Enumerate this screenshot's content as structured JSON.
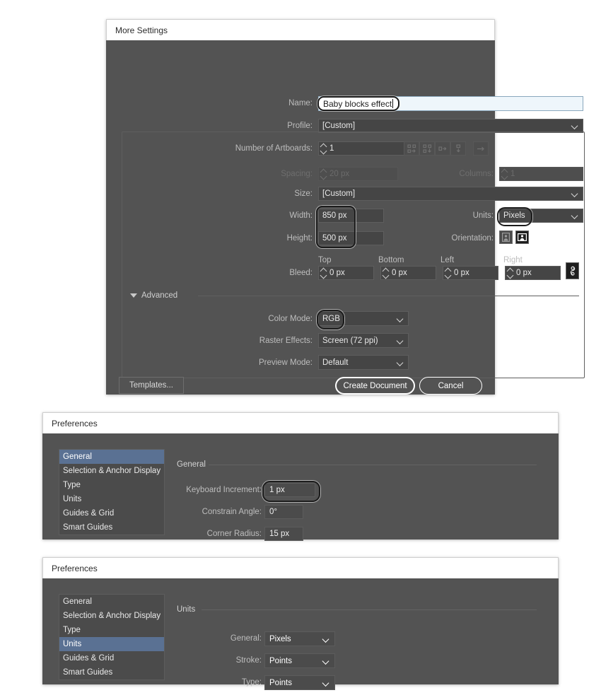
{
  "new_document": {
    "title": "More Settings",
    "name": {
      "label": "Name:",
      "value": "Baby blocks effect"
    },
    "profile": {
      "label": "Profile:",
      "value": "[Custom]"
    },
    "artboards": {
      "label": "Number of Artboards:",
      "value": "1"
    },
    "arrange_icons": [
      "grid-by-row-icon",
      "grid-by-column-icon",
      "arrange-left-to-right-icon",
      "arrange-top-to-bottom-icon",
      "change-order-icon"
    ],
    "spacing": {
      "label": "Spacing:",
      "value": "20 px",
      "disabled": true
    },
    "columns": {
      "label": "Columns:",
      "value": "1",
      "disabled": true
    },
    "size": {
      "label": "Size:",
      "value": "[Custom]"
    },
    "width": {
      "label": "Width:",
      "value": "850 px"
    },
    "height": {
      "label": "Height:",
      "value": "500 px"
    },
    "units": {
      "label": "Units:",
      "value": "Pixels"
    },
    "orientation": {
      "label": "Orientation:",
      "portrait_selected": false,
      "landscape_selected": true
    },
    "bleed": {
      "label": "Bleed:",
      "headers": [
        "Top",
        "Bottom",
        "Left",
        "Right"
      ],
      "values": [
        "0 px",
        "0 px",
        "0 px",
        "0 px"
      ],
      "link_icon": "link-chain-icon"
    },
    "advanced": {
      "label": "Advanced",
      "color_mode": {
        "label": "Color Mode:",
        "value": "RGB"
      },
      "raster_effects": {
        "label": "Raster Effects:",
        "value": "Screen (72 ppi)"
      },
      "preview_mode": {
        "label": "Preview Mode:",
        "value": "Default"
      }
    },
    "buttons": {
      "templates": "Templates...",
      "create": "Create Document",
      "cancel": "Cancel"
    }
  },
  "preferences_general": {
    "title": "Preferences",
    "sidebar": [
      {
        "label": "General",
        "selected": true
      },
      {
        "label": "Selection & Anchor Display",
        "selected": false
      },
      {
        "label": "Type",
        "selected": false
      },
      {
        "label": "Units",
        "selected": false
      },
      {
        "label": "Guides & Grid",
        "selected": false
      },
      {
        "label": "Smart Guides",
        "selected": false
      }
    ],
    "pane_title": "General",
    "fields": [
      {
        "label": "Keyboard Increment:",
        "value": "1 px",
        "highlighted": true
      },
      {
        "label": "Constrain Angle:",
        "value": "0°",
        "highlighted": false
      },
      {
        "label": "Corner Radius:",
        "value": "15 px",
        "highlighted": false
      }
    ]
  },
  "preferences_units": {
    "title": "Preferences",
    "sidebar": [
      {
        "label": "General",
        "selected": false
      },
      {
        "label": "Selection & Anchor Display",
        "selected": false
      },
      {
        "label": "Type",
        "selected": false
      },
      {
        "label": "Units",
        "selected": true
      },
      {
        "label": "Guides & Grid",
        "selected": false
      },
      {
        "label": "Smart Guides",
        "selected": false
      }
    ],
    "pane_title": "Units",
    "fields": [
      {
        "label": "General:",
        "value": "Pixels"
      },
      {
        "label": "Stroke:",
        "value": "Points"
      },
      {
        "label": "Type:",
        "value": "Points"
      }
    ]
  },
  "colors": {
    "dialog_bg": "#535353",
    "field_bg": "#454545",
    "titlebar_bg": "#ffffff",
    "selection_blue": "#5a7193",
    "page_bg": "#ffffff"
  }
}
